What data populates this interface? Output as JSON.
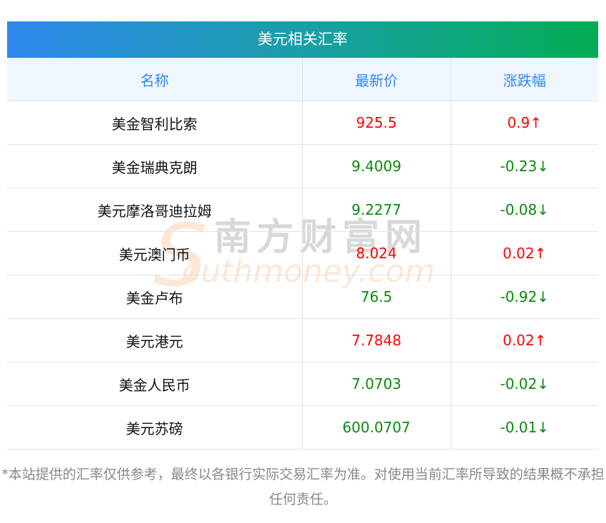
{
  "title": "美元相关汇率",
  "columns": [
    "名称",
    "最新价",
    "涨跌幅"
  ],
  "rows": [
    {
      "name": "美金智利比索",
      "price": "925.5",
      "change": "0.9↑",
      "dir": "up"
    },
    {
      "name": "美金瑞典克朗",
      "price": "9.4009",
      "change": "-0.23↓",
      "dir": "down"
    },
    {
      "name": "美元摩洛哥迪拉姆",
      "price": "9.2277",
      "change": "-0.08↓",
      "dir": "down"
    },
    {
      "name": "美元澳门币",
      "price": "8.024",
      "change": "0.02↑",
      "dir": "up"
    },
    {
      "name": "美金卢布",
      "price": "76.5",
      "change": "-0.92↓",
      "dir": "down"
    },
    {
      "name": "美元港元",
      "price": "7.7848",
      "change": "0.02↑",
      "dir": "up"
    },
    {
      "name": "美金人民币",
      "price": "7.0703",
      "change": "-0.02↓",
      "dir": "down"
    },
    {
      "name": "美元苏磅",
      "price": "600.0707",
      "change": "-0.01↓",
      "dir": "down"
    }
  ],
  "note": "*本站提供的汇率仅供参考，最终以各银行实际交易汇率为准。对使用当前汇率所导致的结果概不承担任何责任。",
  "watermark": {
    "cn": "南方财富网",
    "en": "outhmoney.com",
    "s": "S"
  }
}
